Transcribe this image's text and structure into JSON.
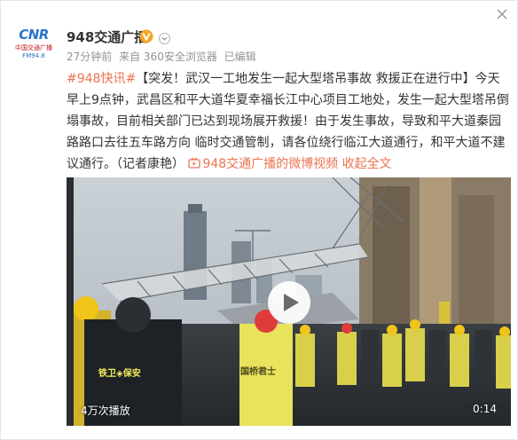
{
  "avatar": {
    "logo_text": "CNR",
    "line1": "中国交通广播",
    "line2": "FM94.8"
  },
  "header": {
    "username": "948交通广播",
    "verified_icon": "verified-badge-icon",
    "dropdown_icon": "chevron-down-icon",
    "close_icon": "close-icon"
  },
  "meta": {
    "time": "27分钟前",
    "source": "来自 360安全浏览器",
    "edited": "已编辑"
  },
  "post": {
    "hashtag": "#948快讯#",
    "text": "【突发！武汉一工地发生一起大型塔吊事故  救援正在进行中】今天早上9点钟，武昌区和平大道华夏幸福长江中心项目工地处，发生一起大型塔吊倒塌事故，目前相关部门已达到现场展开救援！由于发生事故，导致和平大道秦园路路口去往五车路方向 临时交通管制，请各位绕行临江大道通行，和平大道不建议通行。（记者康艳）",
    "video_link_icon": "video-icon",
    "video_link": "948交通广播的微博视频",
    "collapse_link": "收起全文"
  },
  "video": {
    "play_count": "4万次播放",
    "duration": "0:14",
    "vest_label_1": "铁卫",
    "vest_label_1b": "保安",
    "vest_label_2": "国桥君士"
  },
  "colors": {
    "link": "#eb7350",
    "meta": "#939393",
    "text": "#333333",
    "verified": "#f5a623"
  }
}
